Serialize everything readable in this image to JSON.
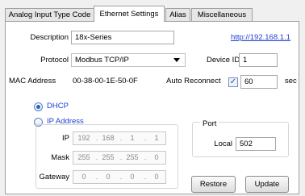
{
  "tabs": [
    {
      "label": "Analog Input Type Code",
      "active": false
    },
    {
      "label": "Ethernet Settings",
      "active": true
    },
    {
      "label": "Alias",
      "active": false
    },
    {
      "label": "Miscellaneous",
      "active": false
    }
  ],
  "form": {
    "description_label": "Description",
    "description_value": "18x-Series",
    "link_text": "http://192.168.1.1",
    "protocol_label": "Protocol",
    "protocol_value": "Modbus TCP/IP",
    "device_id_label": "Device ID",
    "device_id_value": "1",
    "mac_label": "MAC Address",
    "mac_value": "00-38-00-1E-50-0F",
    "auto_reconnect_label": "Auto Reconnect",
    "auto_reconnect_checked": true,
    "auto_reconnect_value": "60",
    "auto_reconnect_unit": "sec"
  },
  "network": {
    "dhcp_label": "DHCP",
    "dhcp_selected": true,
    "ip_address_label": "IP Address",
    "ip_address_selected": false,
    "ip_label": "IP",
    "ip": [
      "192",
      "168",
      "1",
      "1"
    ],
    "mask_label": "Mask",
    "mask": [
      "255",
      "255",
      "255",
      "0"
    ],
    "gateway_label": "Gateway",
    "gateway": [
      "0",
      "0",
      "0",
      "0"
    ],
    "separator": "."
  },
  "port": {
    "title": "Port",
    "local_label": "Local",
    "local_value": "502"
  },
  "buttons": {
    "restore": "Restore",
    "update": "Update"
  },
  "icons": {
    "dropdown": "chevron-down-icon",
    "checkbox": "checkmark-icon"
  }
}
